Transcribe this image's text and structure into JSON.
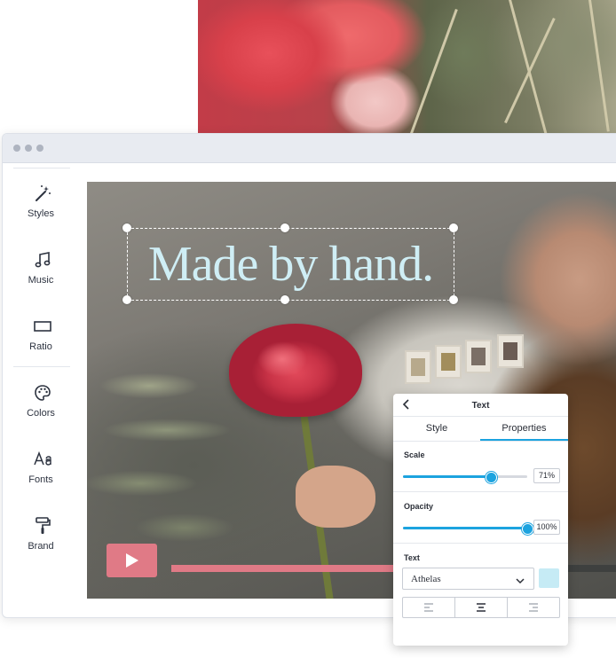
{
  "sidebar": {
    "items": [
      {
        "label": "Styles",
        "icon": "magic-wand-icon"
      },
      {
        "label": "Music",
        "icon": "music-note-icon"
      },
      {
        "label": "Ratio",
        "icon": "aspect-ratio-icon"
      },
      {
        "label": "Colors",
        "icon": "palette-icon"
      },
      {
        "label": "Fonts",
        "icon": "font-icon"
      },
      {
        "label": "Brand",
        "icon": "paint-roller-icon"
      }
    ]
  },
  "video": {
    "headline": "Made by hand.",
    "progress_fraction": 0.52
  },
  "panel": {
    "title": "Text",
    "tabs": [
      {
        "label": "Style",
        "active": false
      },
      {
        "label": "Properties",
        "active": true
      }
    ],
    "scale": {
      "label": "Scale",
      "value": "71%",
      "fraction": 0.71
    },
    "opacity": {
      "label": "Opacity",
      "value": "100%",
      "fraction": 1.0
    },
    "text": {
      "label": "Text",
      "font": "Athelas",
      "color": "#c6ebf5",
      "alignment": "center"
    }
  },
  "colors": {
    "accent": "#1ca3df",
    "play_button": "#e07a86",
    "headline_text": "#cfeef5"
  }
}
